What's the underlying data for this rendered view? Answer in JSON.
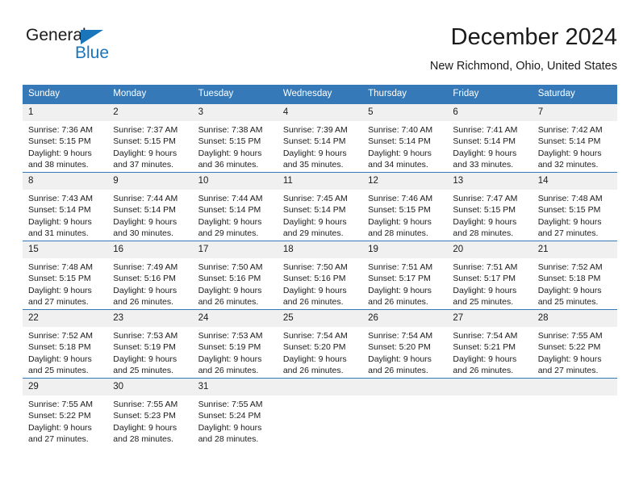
{
  "brand": {
    "name_top": "General",
    "name_bottom": "Blue",
    "accent_color": "#1a75bb"
  },
  "header": {
    "title": "December 2024",
    "location": "New Richmond, Ohio, United States"
  },
  "theme": {
    "header_bg": "#3579b8",
    "header_text": "#ffffff",
    "daynum_bg": "#f0f0f0",
    "row_rule": "#3579b8",
    "body_text": "#1b1b1b"
  },
  "weekday_headers": [
    "Sunday",
    "Monday",
    "Tuesday",
    "Wednesday",
    "Thursday",
    "Friday",
    "Saturday"
  ],
  "labels": {
    "sunrise_prefix": "Sunrise:",
    "sunset_prefix": "Sunset:",
    "daylight_prefix": "Daylight:"
  },
  "weeks": [
    [
      {
        "day": "1",
        "sunrise": "Sunrise: 7:36 AM",
        "sunset": "Sunset: 5:15 PM",
        "daylight1": "Daylight: 9 hours",
        "daylight2": "and 38 minutes."
      },
      {
        "day": "2",
        "sunrise": "Sunrise: 7:37 AM",
        "sunset": "Sunset: 5:15 PM",
        "daylight1": "Daylight: 9 hours",
        "daylight2": "and 37 minutes."
      },
      {
        "day": "3",
        "sunrise": "Sunrise: 7:38 AM",
        "sunset": "Sunset: 5:15 PM",
        "daylight1": "Daylight: 9 hours",
        "daylight2": "and 36 minutes."
      },
      {
        "day": "4",
        "sunrise": "Sunrise: 7:39 AM",
        "sunset": "Sunset: 5:14 PM",
        "daylight1": "Daylight: 9 hours",
        "daylight2": "and 35 minutes."
      },
      {
        "day": "5",
        "sunrise": "Sunrise: 7:40 AM",
        "sunset": "Sunset: 5:14 PM",
        "daylight1": "Daylight: 9 hours",
        "daylight2": "and 34 minutes."
      },
      {
        "day": "6",
        "sunrise": "Sunrise: 7:41 AM",
        "sunset": "Sunset: 5:14 PM",
        "daylight1": "Daylight: 9 hours",
        "daylight2": "and 33 minutes."
      },
      {
        "day": "7",
        "sunrise": "Sunrise: 7:42 AM",
        "sunset": "Sunset: 5:14 PM",
        "daylight1": "Daylight: 9 hours",
        "daylight2": "and 32 minutes."
      }
    ],
    [
      {
        "day": "8",
        "sunrise": "Sunrise: 7:43 AM",
        "sunset": "Sunset: 5:14 PM",
        "daylight1": "Daylight: 9 hours",
        "daylight2": "and 31 minutes."
      },
      {
        "day": "9",
        "sunrise": "Sunrise: 7:44 AM",
        "sunset": "Sunset: 5:14 PM",
        "daylight1": "Daylight: 9 hours",
        "daylight2": "and 30 minutes."
      },
      {
        "day": "10",
        "sunrise": "Sunrise: 7:44 AM",
        "sunset": "Sunset: 5:14 PM",
        "daylight1": "Daylight: 9 hours",
        "daylight2": "and 29 minutes."
      },
      {
        "day": "11",
        "sunrise": "Sunrise: 7:45 AM",
        "sunset": "Sunset: 5:14 PM",
        "daylight1": "Daylight: 9 hours",
        "daylight2": "and 29 minutes."
      },
      {
        "day": "12",
        "sunrise": "Sunrise: 7:46 AM",
        "sunset": "Sunset: 5:15 PM",
        "daylight1": "Daylight: 9 hours",
        "daylight2": "and 28 minutes."
      },
      {
        "day": "13",
        "sunrise": "Sunrise: 7:47 AM",
        "sunset": "Sunset: 5:15 PM",
        "daylight1": "Daylight: 9 hours",
        "daylight2": "and 28 minutes."
      },
      {
        "day": "14",
        "sunrise": "Sunrise: 7:48 AM",
        "sunset": "Sunset: 5:15 PM",
        "daylight1": "Daylight: 9 hours",
        "daylight2": "and 27 minutes."
      }
    ],
    [
      {
        "day": "15",
        "sunrise": "Sunrise: 7:48 AM",
        "sunset": "Sunset: 5:15 PM",
        "daylight1": "Daylight: 9 hours",
        "daylight2": "and 27 minutes."
      },
      {
        "day": "16",
        "sunrise": "Sunrise: 7:49 AM",
        "sunset": "Sunset: 5:16 PM",
        "daylight1": "Daylight: 9 hours",
        "daylight2": "and 26 minutes."
      },
      {
        "day": "17",
        "sunrise": "Sunrise: 7:50 AM",
        "sunset": "Sunset: 5:16 PM",
        "daylight1": "Daylight: 9 hours",
        "daylight2": "and 26 minutes."
      },
      {
        "day": "18",
        "sunrise": "Sunrise: 7:50 AM",
        "sunset": "Sunset: 5:16 PM",
        "daylight1": "Daylight: 9 hours",
        "daylight2": "and 26 minutes."
      },
      {
        "day": "19",
        "sunrise": "Sunrise: 7:51 AM",
        "sunset": "Sunset: 5:17 PM",
        "daylight1": "Daylight: 9 hours",
        "daylight2": "and 26 minutes."
      },
      {
        "day": "20",
        "sunrise": "Sunrise: 7:51 AM",
        "sunset": "Sunset: 5:17 PM",
        "daylight1": "Daylight: 9 hours",
        "daylight2": "and 25 minutes."
      },
      {
        "day": "21",
        "sunrise": "Sunrise: 7:52 AM",
        "sunset": "Sunset: 5:18 PM",
        "daylight1": "Daylight: 9 hours",
        "daylight2": "and 25 minutes."
      }
    ],
    [
      {
        "day": "22",
        "sunrise": "Sunrise: 7:52 AM",
        "sunset": "Sunset: 5:18 PM",
        "daylight1": "Daylight: 9 hours",
        "daylight2": "and 25 minutes."
      },
      {
        "day": "23",
        "sunrise": "Sunrise: 7:53 AM",
        "sunset": "Sunset: 5:19 PM",
        "daylight1": "Daylight: 9 hours",
        "daylight2": "and 25 minutes."
      },
      {
        "day": "24",
        "sunrise": "Sunrise: 7:53 AM",
        "sunset": "Sunset: 5:19 PM",
        "daylight1": "Daylight: 9 hours",
        "daylight2": "and 26 minutes."
      },
      {
        "day": "25",
        "sunrise": "Sunrise: 7:54 AM",
        "sunset": "Sunset: 5:20 PM",
        "daylight1": "Daylight: 9 hours",
        "daylight2": "and 26 minutes."
      },
      {
        "day": "26",
        "sunrise": "Sunrise: 7:54 AM",
        "sunset": "Sunset: 5:20 PM",
        "daylight1": "Daylight: 9 hours",
        "daylight2": "and 26 minutes."
      },
      {
        "day": "27",
        "sunrise": "Sunrise: 7:54 AM",
        "sunset": "Sunset: 5:21 PM",
        "daylight1": "Daylight: 9 hours",
        "daylight2": "and 26 minutes."
      },
      {
        "day": "28",
        "sunrise": "Sunrise: 7:55 AM",
        "sunset": "Sunset: 5:22 PM",
        "daylight1": "Daylight: 9 hours",
        "daylight2": "and 27 minutes."
      }
    ],
    [
      {
        "day": "29",
        "sunrise": "Sunrise: 7:55 AM",
        "sunset": "Sunset: 5:22 PM",
        "daylight1": "Daylight: 9 hours",
        "daylight2": "and 27 minutes."
      },
      {
        "day": "30",
        "sunrise": "Sunrise: 7:55 AM",
        "sunset": "Sunset: 5:23 PM",
        "daylight1": "Daylight: 9 hours",
        "daylight2": "and 28 minutes."
      },
      {
        "day": "31",
        "sunrise": "Sunrise: 7:55 AM",
        "sunset": "Sunset: 5:24 PM",
        "daylight1": "Daylight: 9 hours",
        "daylight2": "and 28 minutes."
      },
      {
        "day": "",
        "sunrise": "",
        "sunset": "",
        "daylight1": "",
        "daylight2": ""
      },
      {
        "day": "",
        "sunrise": "",
        "sunset": "",
        "daylight1": "",
        "daylight2": ""
      },
      {
        "day": "",
        "sunrise": "",
        "sunset": "",
        "daylight1": "",
        "daylight2": ""
      },
      {
        "day": "",
        "sunrise": "",
        "sunset": "",
        "daylight1": "",
        "daylight2": ""
      }
    ]
  ]
}
